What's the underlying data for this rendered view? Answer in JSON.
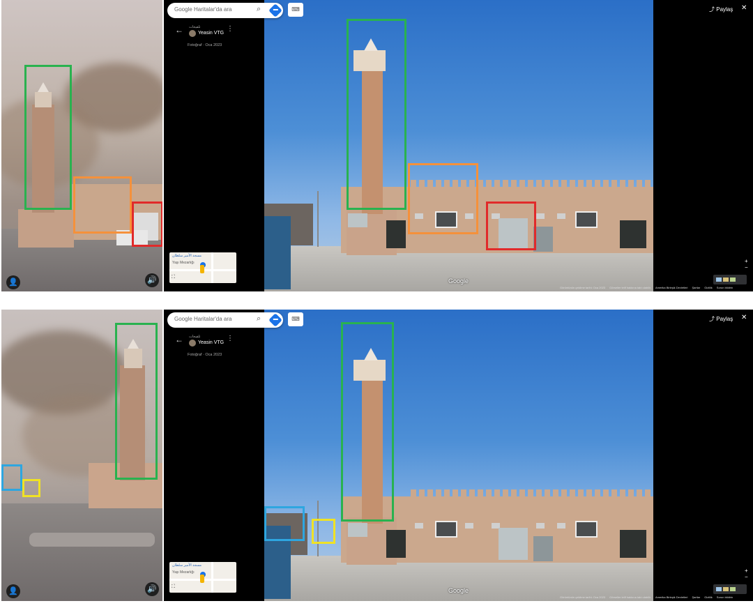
{
  "panels": [
    {
      "search_placeholder": "Google Haritalar'da ara",
      "user_small": "تلقيحات",
      "username": "Yeasin VTG",
      "photo_info": "Fotoğraf · Oca 2023",
      "minimap_text": "مسجد الأمير سلطان",
      "minimap_caption": "Yaşı Mezarlığı",
      "share_label": "Paylaş",
      "google_logo": "Google",
      "footer": [
        "Görüntünün çekilme tarihi: Oca 2023",
        "Görseller telif hakkına tabi olabilir.",
        "Amerika Birleşik Devletleri",
        "Şartlar",
        "Gizlilik",
        "Sorun bildirin"
      ]
    },
    {
      "search_placeholder": "Google Haritalar'da ara",
      "user_small": "تلقيحات",
      "username": "Yeasin VTG",
      "photo_info": "Fotoğraf · Oca 2023",
      "minimap_text": "مسجد الأمير سلطان",
      "minimap_caption": "Yaşı Mezarlığı",
      "share_label": "Paylaş",
      "google_logo": "Google",
      "footer": [
        "Görüntünün çekilme tarihi: Oca 2023",
        "Görseller telif hakkına tabi olabilir.",
        "Amerika Birleşik Devletleri",
        "Şartlar",
        "Gizlilik",
        "Sorun bildirin"
      ]
    }
  ],
  "icons": {
    "search": "⌕",
    "back": "←",
    "kebab": "⋮",
    "share": "⤴",
    "close": "✕",
    "keyboard": "⌨",
    "person": "👤",
    "sound": "🔊",
    "plus": "+",
    "minus": "−",
    "expand": "⛶"
  },
  "colors": {
    "green_box": "#29b24f",
    "orange_box": "#f5913b",
    "red_box": "#e12a2a",
    "blue_box": "#2ea6e0",
    "yellow_box": "#f0e224"
  }
}
